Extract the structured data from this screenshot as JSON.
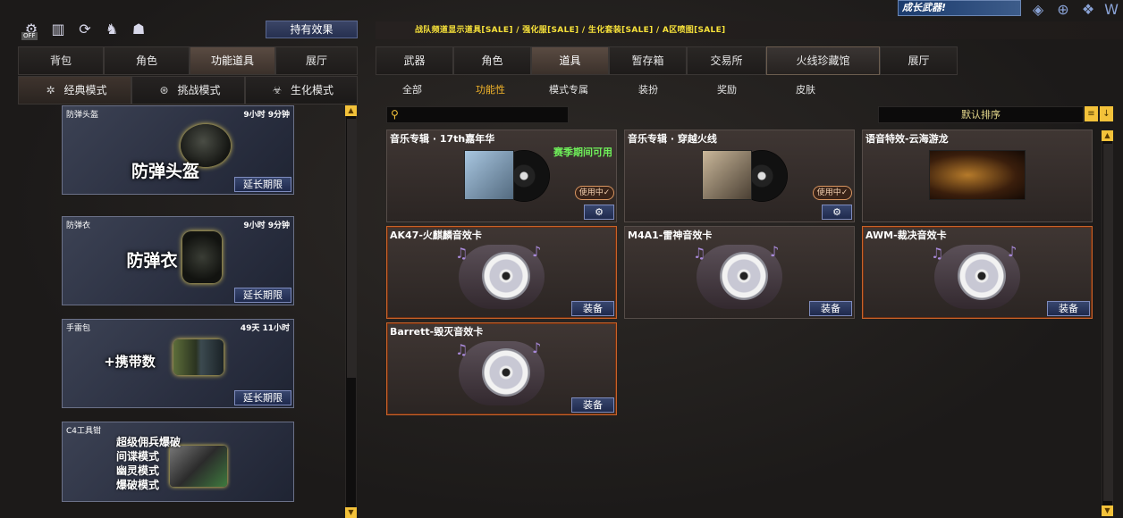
{
  "top_icons": [
    "off-toggle-icon",
    "chart-icon",
    "refresh-icon",
    "character-icon",
    "helmet-icon"
  ],
  "off_label": "OFF",
  "effect_button": "持有效果",
  "left_tabs": [
    "背包",
    "角色",
    "功能道具",
    "展厅"
  ],
  "left_active_tab": 2,
  "mode_tabs": [
    "经典模式",
    "挑战模式",
    "生化模式"
  ],
  "mode_active": 0,
  "left_items": [
    {
      "name": "防弹头盔",
      "time": "9小时 9分钟",
      "title": "防弹头盔",
      "action": "延长期限"
    },
    {
      "name": "防弹衣",
      "time": "9小时 9分钟",
      "title": "防弹衣",
      "action": "延长期限"
    },
    {
      "name": "手雷包",
      "time": "49天 11小时",
      "title": "+携带数",
      "action": "延长期限"
    },
    {
      "name": "C4工具钳",
      "time": "",
      "lines": [
        "超级佣兵爆破",
        "间谍模式",
        "幽灵模式",
        "爆破模式"
      ]
    }
  ],
  "banner_text": "战队频道显示道具[SALE] / 强化服[SALE] / 生化套装[SALE] / A区喷图[SALE]",
  "top_right_brand": "成长武器!",
  "right_tabs": [
    "武器",
    "角色",
    "道具",
    "暂存箱",
    "交易所",
    "火线珍藏馆",
    "展厅"
  ],
  "right_active_tab": 2,
  "sub_tabs": [
    "全部",
    "功能性",
    "模式专属",
    "装扮",
    "奖励",
    "皮肤"
  ],
  "sub_active": 1,
  "search": {
    "placeholder": ""
  },
  "sort_label": "默认排序",
  "items": [
    {
      "name": "音乐专辑 · 17th嘉年华",
      "badge": "赛季期间可用",
      "status": "使用中",
      "type": "album"
    },
    {
      "name": "音乐专辑 · 穿越火线",
      "status": "使用中",
      "type": "album"
    },
    {
      "name": "语音特效-云海游龙",
      "type": "voice"
    },
    {
      "name": "AK47-火麒麟音效卡",
      "action": "装备",
      "type": "cd",
      "selected": true
    },
    {
      "name": "M4A1-雷神音效卡",
      "action": "装备",
      "type": "cd"
    },
    {
      "name": "AWM-裁决音效卡",
      "action": "装备",
      "type": "cd",
      "selected": true
    },
    {
      "name": "Barrett-毁灭音效卡",
      "action": "装备",
      "type": "cd",
      "selected": true
    }
  ]
}
